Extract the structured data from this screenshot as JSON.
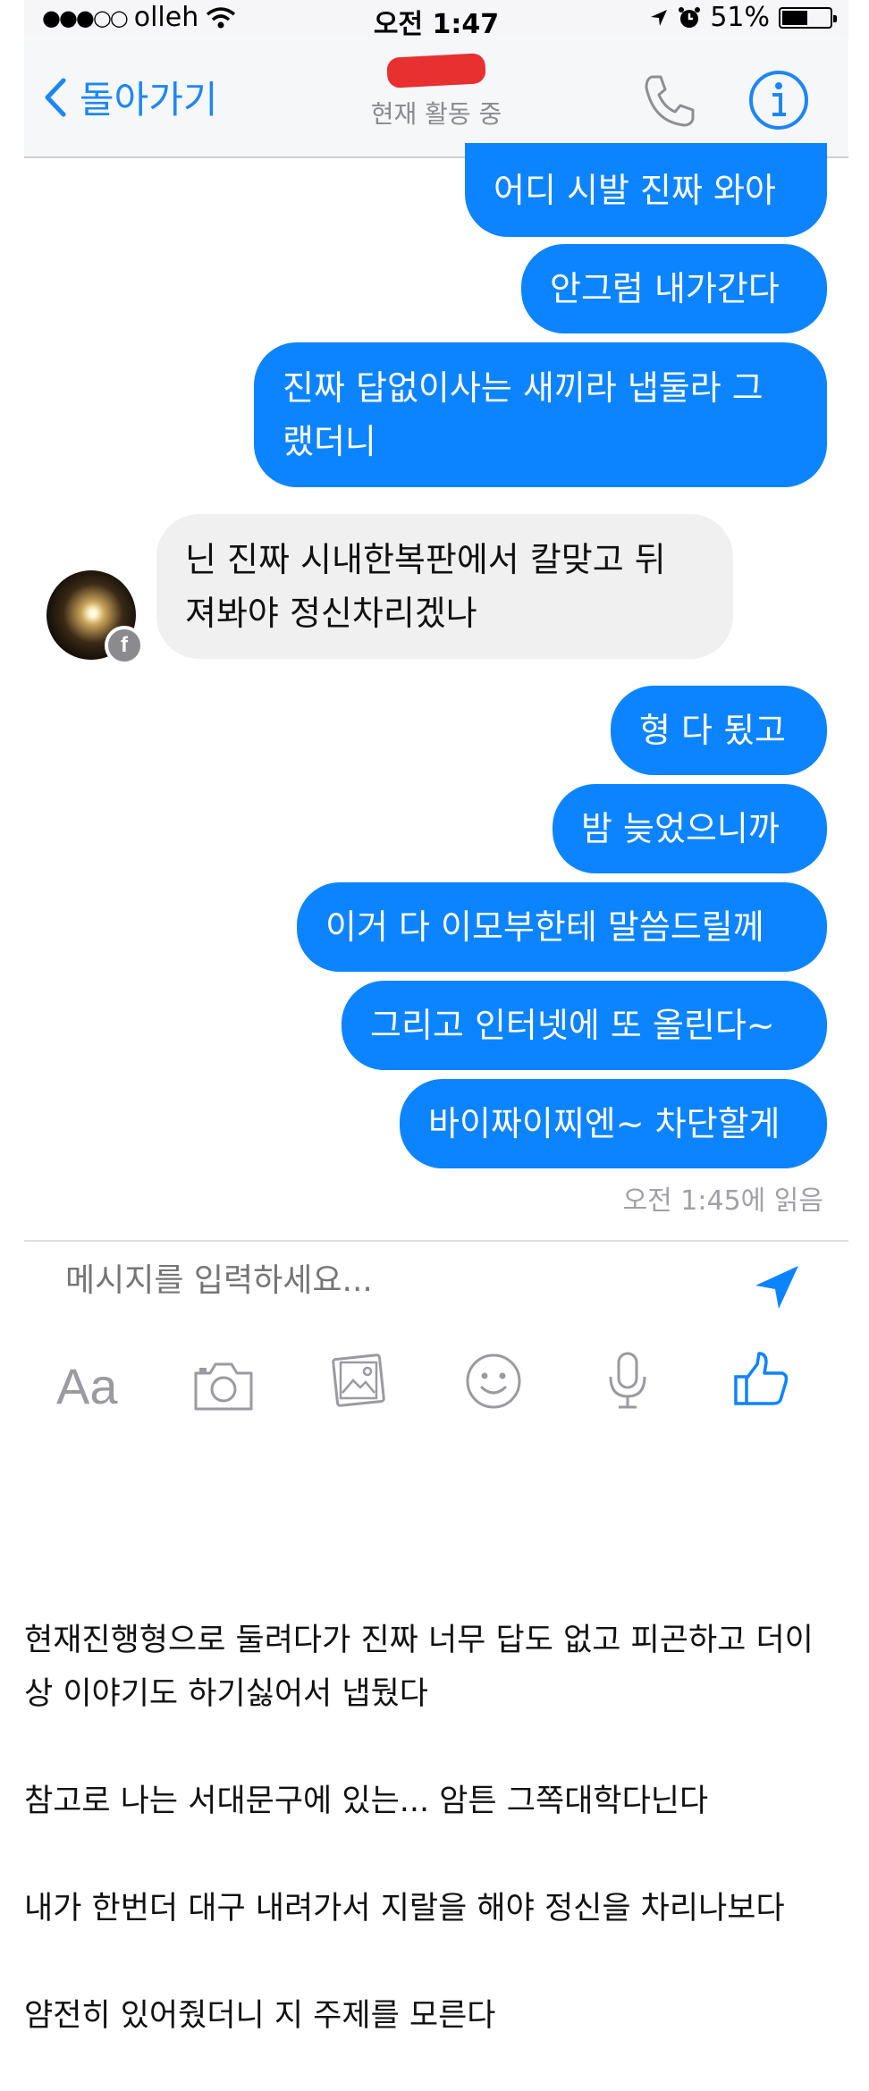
{
  "status_bar": {
    "signal": "●●●○○",
    "carrier": "olleh",
    "time": "오전 1:47",
    "battery": "51%"
  },
  "nav": {
    "back_label": "돌아가기",
    "status": "현재 활동 중"
  },
  "messages": [
    {
      "from": "me",
      "text": "어디 시발 진짜 와아"
    },
    {
      "from": "me",
      "text": "안그럼 내가간다"
    },
    {
      "from": "me",
      "line1": "진짜 답없이사는 새끼라 냅둘라 그",
      "line2": "랬더니"
    },
    {
      "from": "them",
      "line1": "닌 진짜 시내한복판에서 칼맞고 뒤",
      "line2": "져봐야 정신차리겠나"
    },
    {
      "from": "me",
      "text": "형 다 됬고"
    },
    {
      "from": "me",
      "text": "밤 늦었으니까"
    },
    {
      "from": "me",
      "text": "이거 다 이모부한테 말씀드릴께"
    },
    {
      "from": "me",
      "text": "그리고 인터넷에 또 올린다~"
    },
    {
      "from": "me",
      "text": "바이짜이찌엔~ 차단할게"
    }
  ],
  "read_receipt": "오전 1:45에 읽음",
  "composer": {
    "placeholder": "메시지를 입력하세요...",
    "aa_label": "Aa"
  },
  "accent_color": "#0d84ff",
  "article": [
    "현재진행형으로 둘려다가 진짜 너무 답도 없고 피곤하고 더이",
    "상 이야기도 하기싫어서 냅뒀다",
    "",
    "참고로 나는 서대문구에 있는... 암튼 그쪽대학다닌다",
    "",
    "내가 한번더 대구 내려가서 지랄을 해야 정신을 차리나보다",
    "",
    "얌전히 있어줬더니 지 주제를 모른다"
  ]
}
